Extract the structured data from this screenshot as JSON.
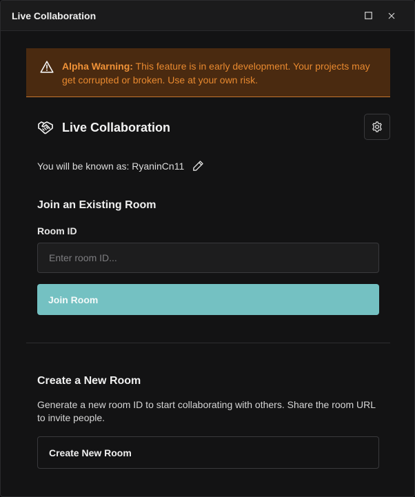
{
  "window": {
    "title": "Live Collaboration",
    "maximize_icon": "maximize-icon",
    "close_icon": "close-icon"
  },
  "warning": {
    "icon": "warning-triangle-icon",
    "label": "Alpha Warning:",
    "message": " This feature is in early development. Your projects may get corrupted or broken. Use at your own risk."
  },
  "header": {
    "icon": "handshake-icon",
    "title": "Live Collaboration",
    "settings_icon": "gear-icon"
  },
  "identity": {
    "text": "You will be known as: RyaninCn11",
    "edit_icon": "pencil-icon"
  },
  "join": {
    "title": "Join an Existing Room",
    "field_label": "Room ID",
    "input_value": "",
    "input_placeholder": "Enter room ID...",
    "button_label": "Join Room"
  },
  "create": {
    "title": "Create a New Room",
    "description": "Generate a new room ID to start collaborating with others. Share the room URL to invite people.",
    "button_label": "Create New Room"
  },
  "colors": {
    "accent": "#74c1c2",
    "warning_bg": "#4a2a10",
    "warning_text": "#e8892f",
    "background": "#131314"
  }
}
